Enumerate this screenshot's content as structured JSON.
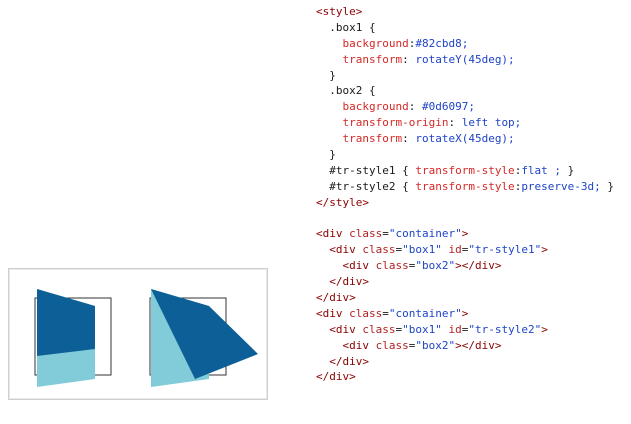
{
  "colors": {
    "box1_color": "#82cbd8",
    "box2_color": "#0d6097",
    "container_border": "#333333"
  },
  "code_lines": [
    [
      {
        "t": "<style>",
        "c": "tag"
      }
    ],
    [
      {
        "t": "  .box1 {",
        "c": "sel"
      }
    ],
    [
      {
        "t": "    background",
        "c": "prop"
      },
      {
        "t": ":",
        "c": "punct"
      },
      {
        "t": "#82cbd8;",
        "c": "val"
      }
    ],
    [
      {
        "t": "    transform",
        "c": "prop"
      },
      {
        "t": ": ",
        "c": "punct"
      },
      {
        "t": "rotateY(45deg);",
        "c": "val"
      }
    ],
    [
      {
        "t": "  }",
        "c": "punct"
      }
    ],
    [
      {
        "t": "  .box2 {",
        "c": "sel"
      }
    ],
    [
      {
        "t": "    background",
        "c": "prop"
      },
      {
        "t": ": ",
        "c": "punct"
      },
      {
        "t": "#0d6097;",
        "c": "val"
      }
    ],
    [
      {
        "t": "    transform-origin",
        "c": "prop"
      },
      {
        "t": ": ",
        "c": "punct"
      },
      {
        "t": "left top;",
        "c": "val"
      }
    ],
    [
      {
        "t": "    transform",
        "c": "prop"
      },
      {
        "t": ": ",
        "c": "punct"
      },
      {
        "t": "rotateX(45deg);",
        "c": "val"
      }
    ],
    [
      {
        "t": "  }",
        "c": "punct"
      }
    ],
    [
      {
        "t": "  #tr-style1 { ",
        "c": "sel"
      },
      {
        "t": "transform-style",
        "c": "prop"
      },
      {
        "t": ":",
        "c": "punct"
      },
      {
        "t": "flat ; ",
        "c": "val"
      },
      {
        "t": "}",
        "c": "punct"
      }
    ],
    [
      {
        "t": "  #tr-style2 { ",
        "c": "sel"
      },
      {
        "t": "transform-style",
        "c": "prop"
      },
      {
        "t": ":",
        "c": "punct"
      },
      {
        "t": "preserve-3d; ",
        "c": "val"
      },
      {
        "t": "}",
        "c": "punct"
      }
    ],
    [
      {
        "t": "</style>",
        "c": "tag"
      }
    ],
    [
      {
        "t": "",
        "c": "punct"
      }
    ],
    [
      {
        "t": "<div ",
        "c": "tag"
      },
      {
        "t": "class",
        "c": "attr"
      },
      {
        "t": "=",
        "c": "punct"
      },
      {
        "t": "\"container\"",
        "c": "str"
      },
      {
        "t": ">",
        "c": "tag"
      }
    ],
    [
      {
        "t": "  <div ",
        "c": "tag"
      },
      {
        "t": "class",
        "c": "attr"
      },
      {
        "t": "=",
        "c": "punct"
      },
      {
        "t": "\"box1\"",
        "c": "str"
      },
      {
        "t": " id",
        "c": "attr"
      },
      {
        "t": "=",
        "c": "punct"
      },
      {
        "t": "\"tr-style1\"",
        "c": "str"
      },
      {
        "t": ">",
        "c": "tag"
      }
    ],
    [
      {
        "t": "    <div ",
        "c": "tag"
      },
      {
        "t": "class",
        "c": "attr"
      },
      {
        "t": "=",
        "c": "punct"
      },
      {
        "t": "\"box2\"",
        "c": "str"
      },
      {
        "t": "></div>",
        "c": "tag"
      }
    ],
    [
      {
        "t": "  </div>",
        "c": "tag"
      }
    ],
    [
      {
        "t": "</div>",
        "c": "tag"
      }
    ],
    [
      {
        "t": "<div ",
        "c": "tag"
      },
      {
        "t": "class",
        "c": "attr"
      },
      {
        "t": "=",
        "c": "punct"
      },
      {
        "t": "\"container\"",
        "c": "str"
      },
      {
        "t": ">",
        "c": "tag"
      }
    ],
    [
      {
        "t": "  <div ",
        "c": "tag"
      },
      {
        "t": "class",
        "c": "attr"
      },
      {
        "t": "=",
        "c": "punct"
      },
      {
        "t": "\"box1\"",
        "c": "str"
      },
      {
        "t": " id",
        "c": "attr"
      },
      {
        "t": "=",
        "c": "punct"
      },
      {
        "t": "\"tr-style2\"",
        "c": "str"
      },
      {
        "t": ">",
        "c": "tag"
      }
    ],
    [
      {
        "t": "    <div ",
        "c": "tag"
      },
      {
        "t": "class",
        "c": "attr"
      },
      {
        "t": "=",
        "c": "punct"
      },
      {
        "t": "\"box2\"",
        "c": "str"
      },
      {
        "t": "></div>",
        "c": "tag"
      }
    ],
    [
      {
        "t": "  </div>",
        "c": "tag"
      }
    ],
    [
      {
        "t": "</div>",
        "c": "tag"
      }
    ]
  ]
}
